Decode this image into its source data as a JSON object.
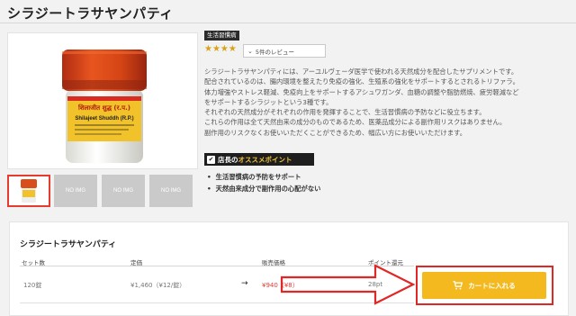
{
  "page": {
    "title": "シラジートラサヤンパティ"
  },
  "product_image": {
    "label_top": "शिलाजीत शुद्ध (र.प.)",
    "label_main": "Shilajeet Shuddh (R.P.)"
  },
  "thumbnails": [
    "NO IMG",
    "NO IMG",
    "NO IMG"
  ],
  "badge": "生活習慣病",
  "rating": {
    "stars": "★★★★",
    "review_link": "5件のレビュー"
  },
  "description": [
    "シラジートラサヤンパティには、アーユルヴェーダ医学で使われる天然成分を配合したサプリメントです。",
    "配合されているのは、腸内環境を整えたり免疫の強化、生殖系の強化をサポートするとされるトリファラ。",
    "体力増強やストレス軽減、免疫向上をサポートするアシュワガンダ、血糖の調整や脂肪燃焼、疲労軽減など",
    "をサポートするシラジットという3種です。",
    "それぞれの天然成分がそれぞれの作用を発揮することで、生活習慣病の予防などに役立ちます。",
    "これらの作用は全て天然由来の成分のものであるため、医薬品成分による副作用リスクはありません。",
    "副作用のリスクなくお使いいただくことができるため、幅広い方にお使いいただけます。"
  ],
  "recommend": {
    "prefix": "店長の",
    "emphasis": "オススメポイント"
  },
  "points": [
    "生活習慣病の予防をサポート",
    "天然由来成分で副作用の心配がない"
  ],
  "variants": {
    "title": "シラジートラサヤンパティ",
    "headers": {
      "set": "セット数",
      "list_price": "定価",
      "sale_price": "販売価格",
      "points": "ポイント還元"
    },
    "row": {
      "set": "120錠",
      "list_price": "¥1,460（¥12/錠）",
      "arrow": "→",
      "sale_price": "¥940（¥8）",
      "points": "28pt"
    },
    "cart_button": "カートに入れる"
  },
  "colors": {
    "accent": "#f3b91f",
    "price_red": "#e23a2e",
    "annotation_red": "#e12626",
    "star": "#d8a319"
  }
}
